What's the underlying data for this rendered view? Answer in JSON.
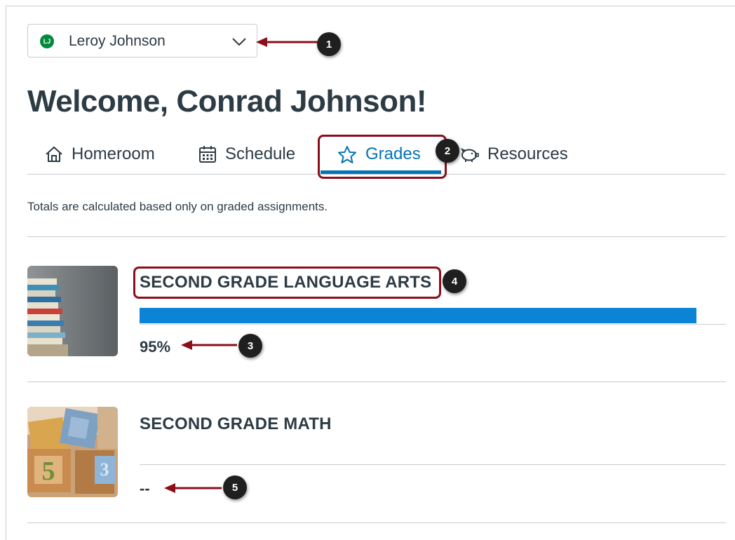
{
  "observer": {
    "avatar_initials": "LJ",
    "name": "Leroy Johnson"
  },
  "welcome": "Welcome, Conrad Johnson!",
  "tabs": [
    {
      "label": "Homeroom",
      "icon": "home-icon",
      "active": false
    },
    {
      "label": "Schedule",
      "icon": "calendar-icon",
      "active": false
    },
    {
      "label": "Grades",
      "icon": "star-icon",
      "active": true
    },
    {
      "label": "Resources",
      "icon": "piggy-bank-icon",
      "active": false
    }
  ],
  "note": "Totals are calculated based only on graded assignments.",
  "courses": [
    {
      "title": "SECOND GRADE LANGUAGE ARTS",
      "score": "95%",
      "progress": 0.95,
      "image": "stacked-books"
    },
    {
      "title": "SECOND GRADE MATH",
      "score": "--",
      "progress": 0,
      "image": "alphabet-blocks"
    }
  ],
  "callouts": [
    "1",
    "2",
    "3",
    "4",
    "5"
  ],
  "colors": {
    "accent": "#0374b5",
    "bar": "#0b84d6",
    "text": "#2d3b45",
    "highlight": "#8b0e1a",
    "avatar": "#03893d"
  }
}
